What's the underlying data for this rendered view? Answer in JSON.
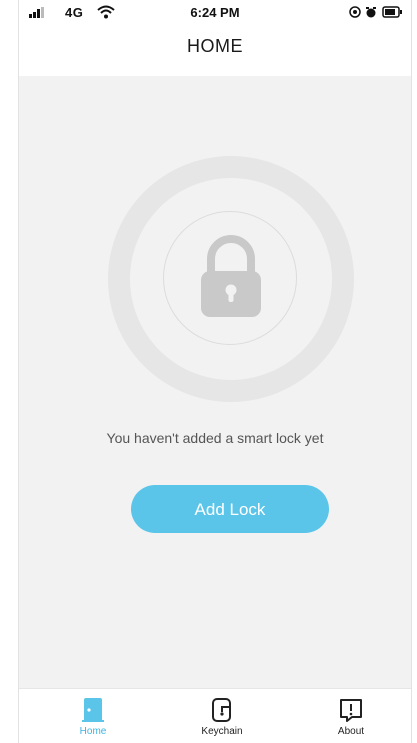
{
  "status_bar": {
    "network": "4G",
    "time": "6:24 PM"
  },
  "header": {
    "title": "HOME"
  },
  "main": {
    "empty_message": "You haven't added a smart lock yet",
    "add_lock_label": "Add Lock"
  },
  "tabs": [
    {
      "label": "Home",
      "icon": "door-icon",
      "active": true
    },
    {
      "label": "Keychain",
      "icon": "keychain-icon",
      "active": false
    },
    {
      "label": "About",
      "icon": "info-icon",
      "active": false
    }
  ],
  "colors": {
    "accent": "#5bc5e9",
    "active_tab": "#3db3e2",
    "background": "#f2f2f2"
  }
}
